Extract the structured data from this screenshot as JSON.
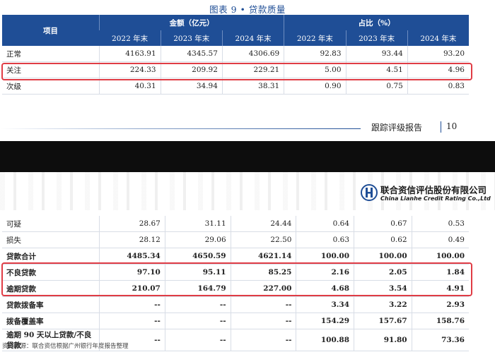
{
  "figure_title": "图表 9 • 贷款质量",
  "header": {
    "item": "项目",
    "amount_group": "金额（亿元）",
    "ratio_group": "占比（%）",
    "years": [
      "2022 年末",
      "2023 年末",
      "2024 年末"
    ]
  },
  "top_rows": [
    {
      "label": "正常",
      "v": [
        "4163.91",
        "4345.57",
        "4306.69",
        "92.83",
        "93.44",
        "93.20"
      ]
    },
    {
      "label": "关注",
      "v": [
        "224.33",
        "209.92",
        "229.21",
        "5.00",
        "4.51",
        "4.96"
      ]
    },
    {
      "label": "次级",
      "v": [
        "40.31",
        "34.94",
        "38.31",
        "0.90",
        "0.75",
        "0.83"
      ]
    }
  ],
  "footer": {
    "report": "跟踪评级报告",
    "page": "10"
  },
  "logo": {
    "cn": "联合资信评估股份有限公司",
    "en": "China Lianhe Credit Rating Co.,Ltd"
  },
  "bottom_rows": [
    {
      "label": "可疑",
      "v": [
        "28.67",
        "31.11",
        "24.44",
        "0.64",
        "0.67",
        "0.53"
      ]
    },
    {
      "label": "损失",
      "v": [
        "28.12",
        "29.06",
        "22.50",
        "0.63",
        "0.62",
        "0.49"
      ]
    },
    {
      "label": "贷款合计",
      "v": [
        "4485.34",
        "4650.59",
        "4621.14",
        "100.00",
        "100.00",
        "100.00"
      ]
    },
    {
      "label": "不良贷款",
      "v": [
        "97.10",
        "95.11",
        "85.25",
        "2.16",
        "2.05",
        "1.84"
      ]
    },
    {
      "label": "逾期贷款",
      "v": [
        "210.07",
        "164.79",
        "227.00",
        "4.68",
        "3.54",
        "4.91"
      ]
    },
    {
      "label": "贷款拨备率",
      "v": [
        "--",
        "--",
        "--",
        "3.34",
        "3.22",
        "2.93"
      ]
    },
    {
      "label": "拨备覆盖率",
      "v": [
        "--",
        "--",
        "--",
        "154.29",
        "157.67",
        "158.76"
      ]
    },
    {
      "label": "逾期 90 天以上贷款/不良贷款",
      "v": [
        "--",
        "--",
        "--",
        "100.88",
        "91.80",
        "73.36"
      ]
    }
  ],
  "source": "资料来源：联合资信根据广州银行年度报告整理",
  "colors": {
    "header_blue": "#1f4e96",
    "highlight_red": "#e03c45"
  }
}
